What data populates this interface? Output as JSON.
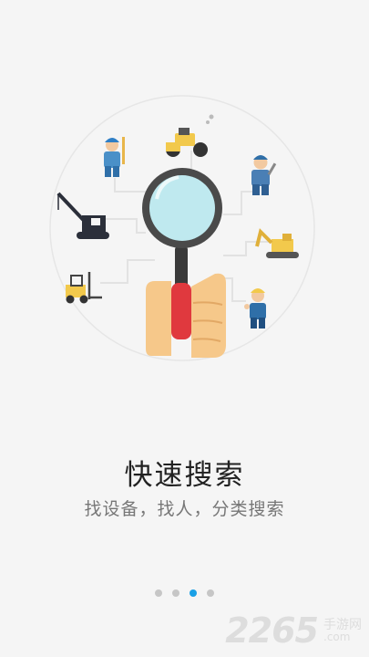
{
  "onboarding": {
    "title": "快速搜索",
    "subtitle": "找设备，找人，分类搜索",
    "page_indicator": {
      "total": 4,
      "active_index": 2
    }
  },
  "illustration": {
    "icons": [
      "surveyor-icon",
      "road-roller-icon",
      "worker-wrench-icon",
      "crane-icon",
      "excavator-icon",
      "forklift-icon",
      "worker-thumbs-up-icon",
      "magnifier-in-hand-icon"
    ]
  },
  "watermark": {
    "mark": "2265",
    "text": "手游网",
    "url": ".com"
  },
  "colors": {
    "background": "#f5f5f5",
    "accent": "#1aa0e6",
    "dot_inactive": "#c6c6c6",
    "title": "#222222",
    "subtitle": "#777777"
  }
}
